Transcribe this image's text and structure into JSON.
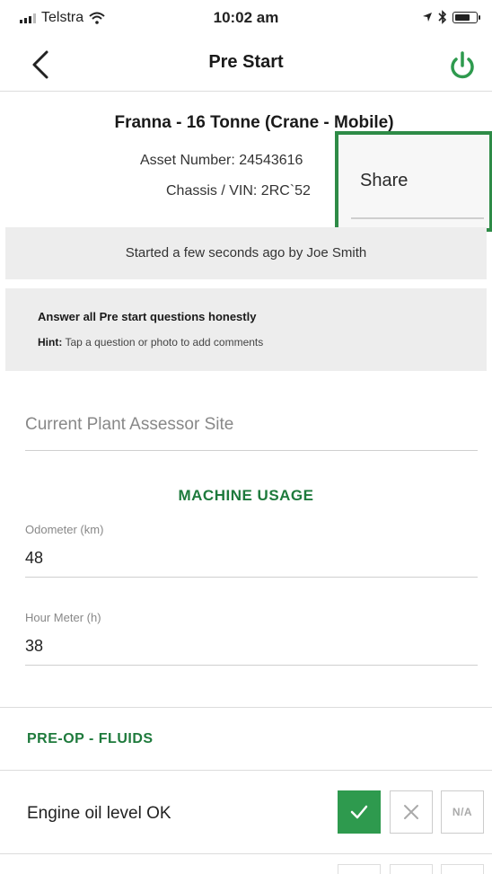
{
  "status_bar": {
    "carrier": "Telstra",
    "time": "10:02 am",
    "icons": [
      "signal-icon",
      "wifi-icon",
      "location-icon",
      "bluetooth-icon",
      "battery-icon"
    ]
  },
  "nav": {
    "title": "Pre Start",
    "back_icon": "chevron-left-icon",
    "power_icon": "power-icon"
  },
  "asset": {
    "name": "Franna - 16 Tonne (Crane - Mobile)",
    "asset_number": "Asset Number: 24543616",
    "chassis_vin": "Chassis / VIN: 2RC`52"
  },
  "share_menu": {
    "label": "Share"
  },
  "started_banner": {
    "text": "Started a few seconds ago by Joe Smith"
  },
  "instructions": {
    "title": "Answer all Pre start questions honestly",
    "hint_label": "Hint:",
    "hint_text": " Tap a question or photo to add comments"
  },
  "site_field": {
    "placeholder": "Current Plant Assessor Site"
  },
  "machine_usage": {
    "title": "MACHINE USAGE",
    "odometer_label": "Odometer (km)",
    "odometer_value": "48",
    "hour_meter_label": "Hour Meter (h)",
    "hour_meter_value": "38"
  },
  "pre_op_fluids": {
    "title": "PRE-OP - FLUIDS",
    "questions": [
      {
        "label": "Engine oil level OK",
        "selected": "yes",
        "na_label": "N/A"
      }
    ]
  },
  "colors": {
    "accent_green": "#2e9a4e",
    "section_green": "#1e7a3c",
    "share_border": "#2e8b47"
  }
}
